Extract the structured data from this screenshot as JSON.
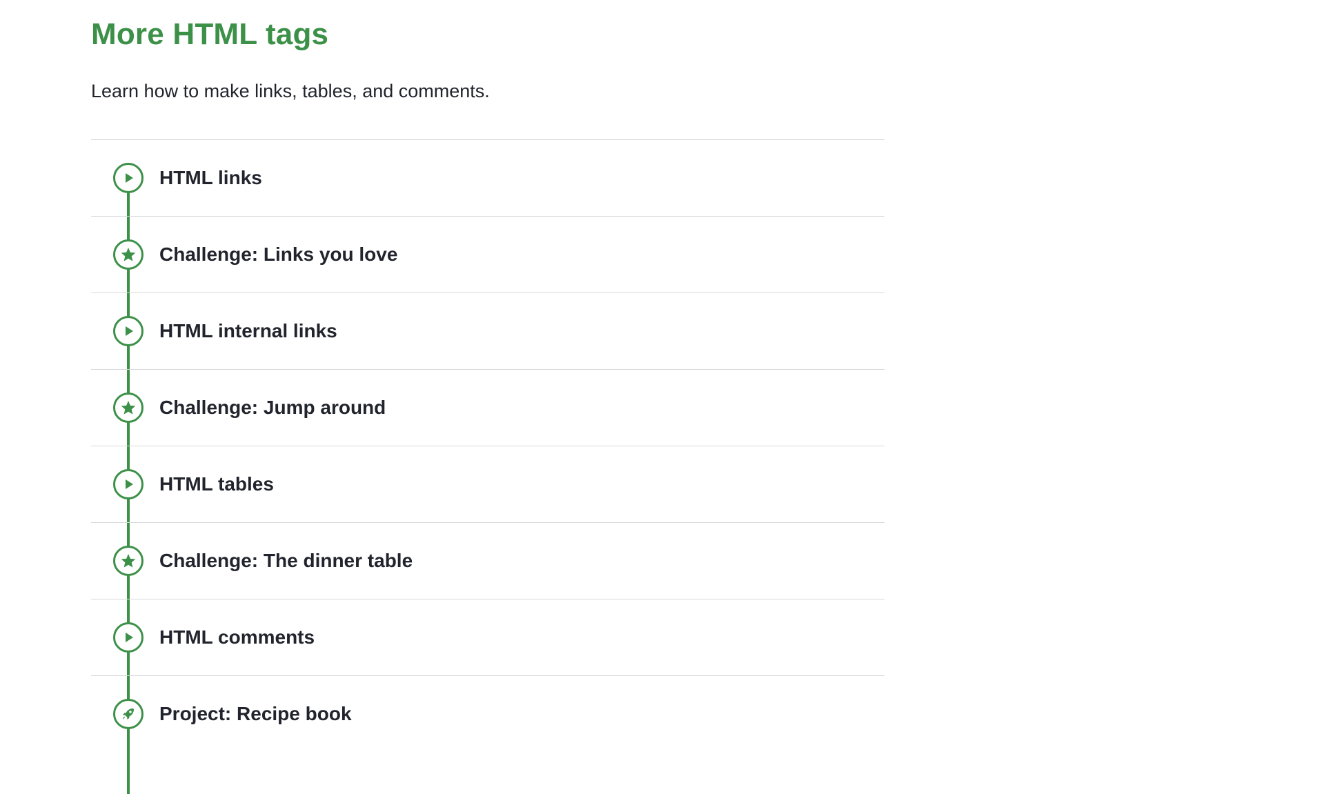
{
  "unit": {
    "title": "More HTML tags",
    "description": "Learn how to make links, tables, and comments.",
    "accent_color": "#3c9048",
    "lessons": [
      {
        "label": "HTML links",
        "icon": "play-icon",
        "type": "video"
      },
      {
        "label": "Challenge: Links you love",
        "icon": "star-icon",
        "type": "challenge"
      },
      {
        "label": "HTML internal links",
        "icon": "play-icon",
        "type": "video"
      },
      {
        "label": "Challenge: Jump around",
        "icon": "star-icon",
        "type": "challenge"
      },
      {
        "label": "HTML tables",
        "icon": "play-icon",
        "type": "video"
      },
      {
        "label": "Challenge: The dinner table",
        "icon": "star-icon",
        "type": "challenge"
      },
      {
        "label": "HTML comments",
        "icon": "play-icon",
        "type": "video"
      },
      {
        "label": "Project: Recipe book",
        "icon": "rocket-icon",
        "type": "project"
      }
    ]
  }
}
